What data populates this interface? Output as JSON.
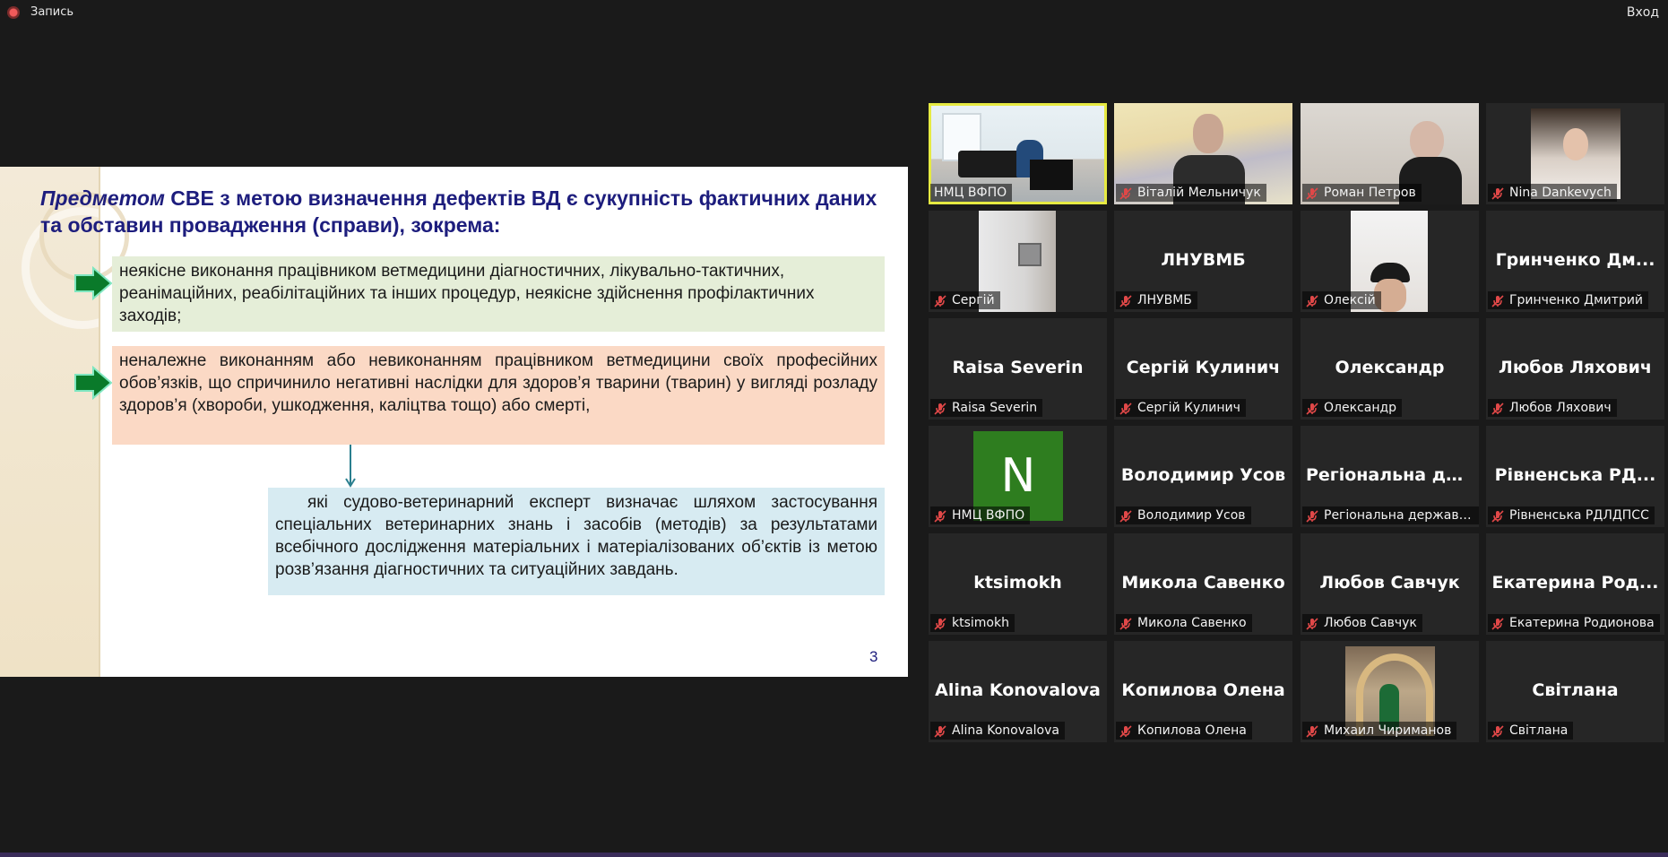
{
  "top_bar": {
    "record_label": "Запись",
    "exit_label": "Вход"
  },
  "slide": {
    "title_em": "Предметом",
    "title_rest": " СВЕ з метою визначення дефектів ВД є сукупність фактичних даних та обставин провадження (справи), зокрема:",
    "item1": "неякісне виконання працівником ветмедицини діагностичних, лікувально-тактичних, реанімаційних, реабілітаційних та інших процедур, неякісне здійснення профілактичних заходів;",
    "item2": "неналежне виконанням або невиконанням працівником ветмедицини своїх професійних обов’язків, що спричинило негативні наслідки для здоров’я тварини (тварин) у вигляді розладу здоров’я (хвороби, ушкодження, каліцтва тощо) або смерті,",
    "item3": "які судово-ветеринарний експерт визначає шляхом застосування спеціальних ветеринарних знань і засобів (методів) за результатами всебічного дослідження матеріальних і матеріалізованих об’єктів із метою розв’язання діагностичних та ситуаційних завдань.",
    "page_number": "3",
    "colors": {
      "title": "#1d1d7d",
      "box1": "#e5eed8",
      "box2": "#fbd9c5",
      "box3": "#d7ebf2",
      "arrow": "#0a7a2a"
    }
  },
  "participants": [
    {
      "display": "",
      "name": "НМЦ ВФПО",
      "video": "office",
      "active": true,
      "muted": false
    },
    {
      "display": "",
      "name": "Віталій Мельничук",
      "video": "wall",
      "muted": true
    },
    {
      "display": "",
      "name": "Роман Петров",
      "video": "room",
      "muted": true
    },
    {
      "display": "",
      "name": "Nina Dankevych",
      "video": "woman",
      "muted": true
    },
    {
      "display": "",
      "name": "Сергій",
      "video": "door",
      "muted": true
    },
    {
      "display": "ЛНУВМБ",
      "name": "ЛНУВМБ",
      "muted": true
    },
    {
      "display": "",
      "name": "Олексій",
      "video": "cap",
      "muted": true
    },
    {
      "display": "Гринченко Дм...",
      "name": "Гринченко Дмитрий",
      "muted": true
    },
    {
      "display": "Raisa Severin",
      "name": "Raisa Severin",
      "muted": true
    },
    {
      "display": "Сергій Кулинич",
      "name": "Сергій Кулинич",
      "muted": true
    },
    {
      "display": "Олександр",
      "name": "Олександр",
      "muted": true
    },
    {
      "display": "Любов Ляхович",
      "name": "Любов Ляхович",
      "muted": true
    },
    {
      "display": "",
      "name": "НМЦ ВФПО",
      "avatar": "N",
      "muted": true
    },
    {
      "display": "Володимир Усов",
      "name": "Володимир Усов",
      "muted": true
    },
    {
      "display": "Регіональна де...",
      "name": "Регіональна державн...",
      "muted": true
    },
    {
      "display": "Рівненська РД...",
      "name": "Рівненська РДЛДПСС",
      "muted": true
    },
    {
      "display": "ktsimokh",
      "name": "ktsimokh",
      "muted": true
    },
    {
      "display": "Микола Савенко",
      "name": "Микола Савенко",
      "muted": true
    },
    {
      "display": "Любов Савчук",
      "name": "Любов Савчук",
      "muted": true
    },
    {
      "display": "Екатерина Род...",
      "name": "Екатерина Родионова",
      "muted": true
    },
    {
      "display": "Alina Konovalova",
      "name": "Alina Konovalova",
      "muted": true
    },
    {
      "display": "Копилова Олена",
      "name": "Копилова Олена",
      "muted": true
    },
    {
      "display": "",
      "name": "Михаил Чириманов",
      "video": "arch",
      "muted": true
    },
    {
      "display": "Світлана",
      "name": "Світлана",
      "muted": true
    }
  ]
}
